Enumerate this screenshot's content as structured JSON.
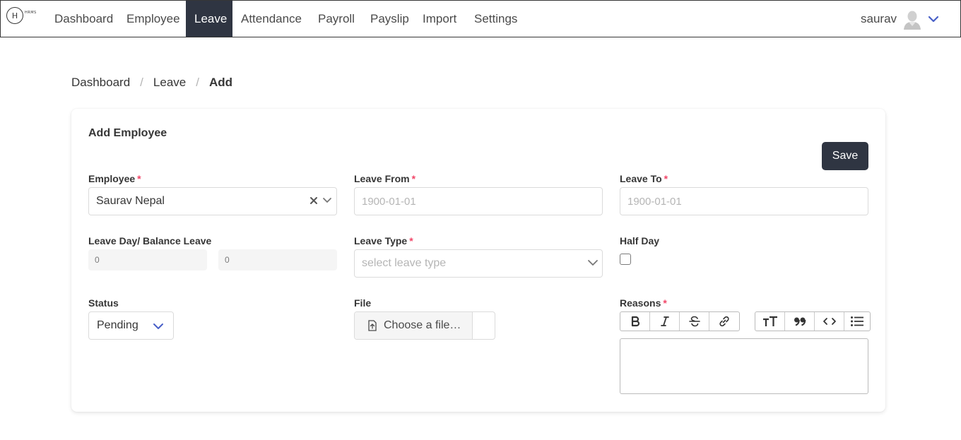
{
  "nav": {
    "logo_letter": "H",
    "logo_text": "HRMS",
    "items": [
      "Dashboard",
      "Employee",
      "Leave",
      "Attendance",
      "Payroll",
      "Payslip",
      "Import",
      "Settings"
    ],
    "active": "Leave",
    "user": "saurav"
  },
  "breadcrumb": {
    "items": [
      "Dashboard",
      "Leave"
    ],
    "separator": "/",
    "current": "Add"
  },
  "form": {
    "title": "Add Employee",
    "save_label": "Save",
    "employee": {
      "label": "Employee",
      "value": "Saurav Nepal"
    },
    "leave_from": {
      "label": "Leave From",
      "placeholder": "1900-01-01"
    },
    "leave_to": {
      "label": "Leave To",
      "placeholder": "1900-01-01"
    },
    "leave_day": {
      "label": "Leave Day/ Balance Leave",
      "day_value": "0",
      "balance_value": "0"
    },
    "leave_type": {
      "label": "Leave Type",
      "placeholder": "select leave type"
    },
    "half_day": {
      "label": "Half Day"
    },
    "status": {
      "label": "Status",
      "value": "Pending"
    },
    "file": {
      "label": "File",
      "cta": "Choose a file…"
    },
    "reasons": {
      "label": "Reasons"
    },
    "required_mark": "*"
  },
  "colors": {
    "dark": "#2f3542",
    "required": "#f14668",
    "accent": "#485fc7"
  }
}
